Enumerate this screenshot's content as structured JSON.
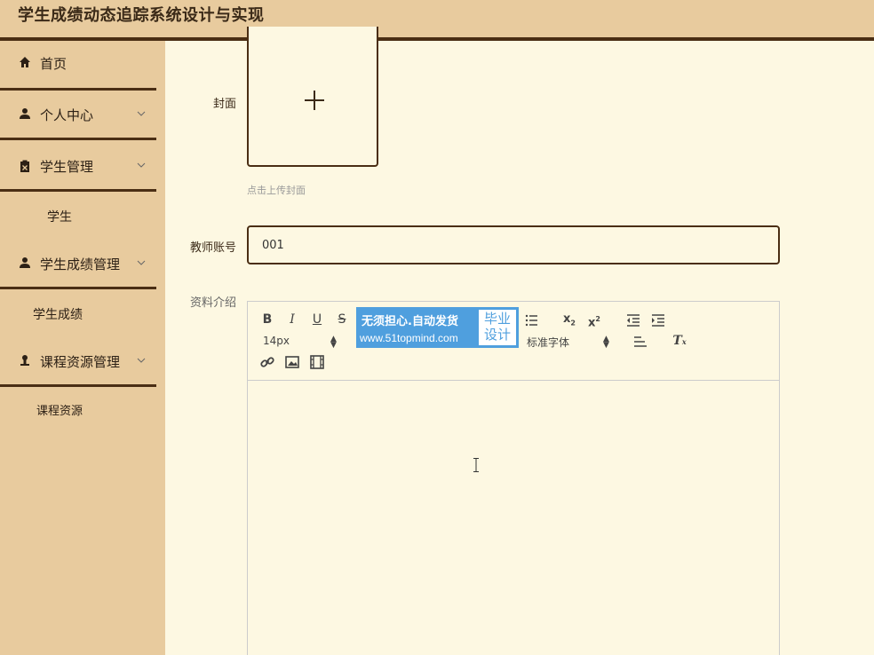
{
  "app": {
    "title": "学生成绩动态追踪系统设计与实现"
  },
  "sidebar": {
    "items": [
      {
        "label": "首页",
        "icon": "home-icon",
        "has_chevron": false
      },
      {
        "label": "个人中心",
        "icon": "user-icon",
        "has_chevron": true
      },
      {
        "label": "学生管理",
        "icon": "clipboard-icon",
        "has_chevron": true
      },
      {
        "label": "学生成绩管理",
        "icon": "user-icon",
        "has_chevron": true
      },
      {
        "label": "课程资源管理",
        "icon": "user-upload-icon",
        "has_chevron": true
      }
    ],
    "subitems": [
      "学生",
      "学生成绩",
      "课程资源"
    ]
  },
  "form": {
    "cover_label": "封面",
    "cover_hint": "点击上传封面",
    "teacher_account_label": "教师账号",
    "teacher_account_value": "001",
    "intro_label": "资料介绍"
  },
  "editor": {
    "font_size": "14px",
    "font_family": "标准字体",
    "toolbar_icons": [
      "bold-icon",
      "italic-icon",
      "underline-icon",
      "strikethrough-icon",
      "bullet-list-icon",
      "subscript-icon",
      "superscript-icon",
      "outdent-icon",
      "indent-icon",
      "align-left-icon",
      "clear-format-icon",
      "link-icon",
      "image-icon",
      "video-icon"
    ]
  },
  "watermark": {
    "line1": "无须担心.自动发货",
    "line2": "www.51topmind.com",
    "badge_line1": "毕业",
    "badge_line2": "设计"
  },
  "colors": {
    "sidebar_bg": "#e8cb9e",
    "page_bg": "#fdf8e2",
    "accent_dark": "#4a2e14",
    "watermark_blue": "#4f9fde"
  }
}
